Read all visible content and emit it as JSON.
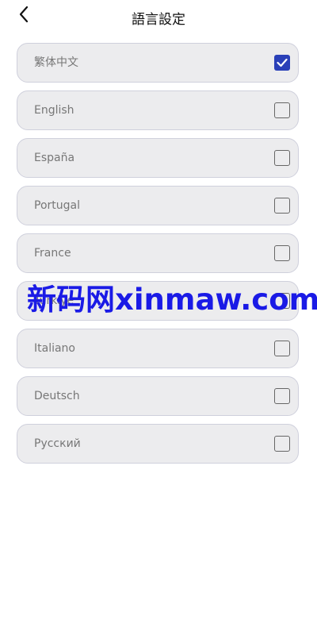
{
  "header": {
    "title": "語言設定",
    "back_icon": "chevron-left-icon"
  },
  "languages": [
    {
      "label": "繁体中文",
      "checked": true
    },
    {
      "label": "English",
      "checked": false
    },
    {
      "label": "España",
      "checked": false
    },
    {
      "label": "Portugal",
      "checked": false
    },
    {
      "label": "France",
      "checked": false
    },
    {
      "label": "Türkiye",
      "checked": false
    },
    {
      "label": "Italiano",
      "checked": false
    },
    {
      "label": "Deutsch",
      "checked": false
    },
    {
      "label": "Русский",
      "checked": false
    }
  ],
  "watermark": {
    "text": "新码网xinmaw.com"
  },
  "colors": {
    "accent": "#2a40b8",
    "item_bg": "#ececee",
    "item_border": "#cfd0dc",
    "watermark": "#1a1ae6"
  }
}
